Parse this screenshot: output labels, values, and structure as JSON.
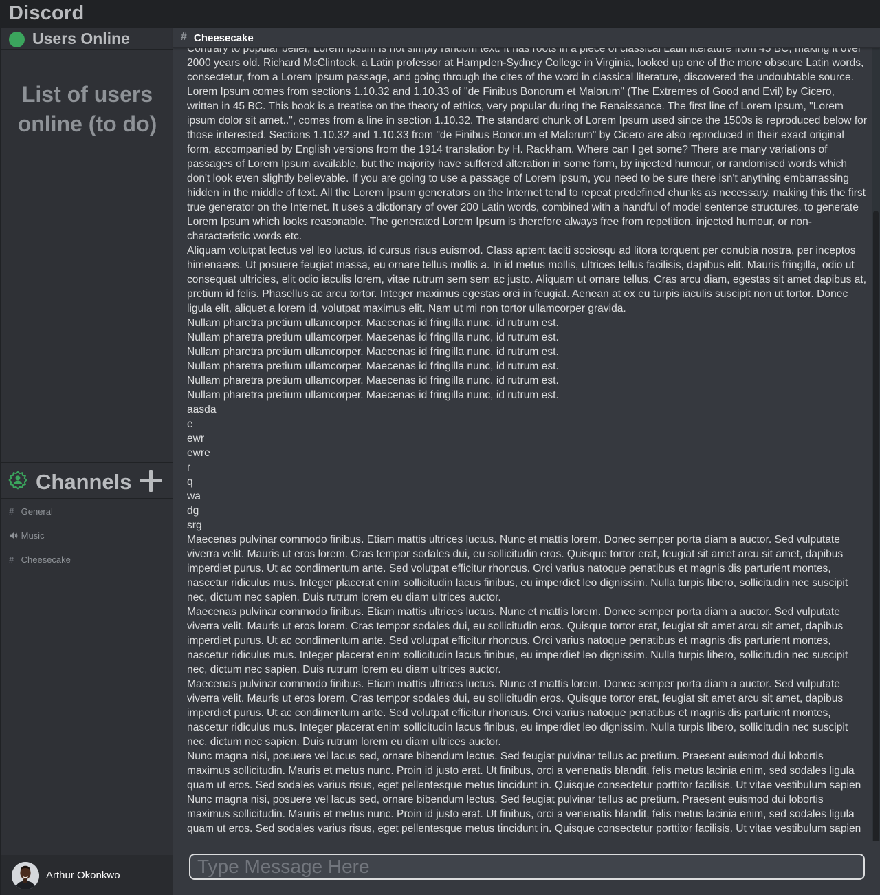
{
  "app": {
    "title": "Discord"
  },
  "users": {
    "header": "Users Online",
    "placeholder": "List of users online (to do)"
  },
  "channels": {
    "header": "Channels",
    "items": [
      {
        "name": "General",
        "type": "text",
        "icon": "hash-icon"
      },
      {
        "name": "Music",
        "type": "voice",
        "icon": "speaker-icon"
      },
      {
        "name": "Cheesecake",
        "type": "text",
        "icon": "hash-icon"
      }
    ]
  },
  "current_user": {
    "name": "Arthur Okonkwo"
  },
  "channel_header": {
    "hash": "#",
    "name": "Cheesecake"
  },
  "messages": [
    "Contrary to popular belief, Lorem Ipsum is not simply random text. It has roots in a piece of classical Latin literature from 45 BC, making it over 2000 years old. Richard McClintock, a Latin professor at Hampden-Sydney College in Virginia, looked up one of the more obscure Latin words, consectetur, from a Lorem Ipsum passage, and going through the cites of the word in classical literature, discovered the undoubtable source. Lorem Ipsum comes from sections 1.10.32 and 1.10.33 of \"de Finibus Bonorum et Malorum\" (The Extremes of Good and Evil) by Cicero, written in 45 BC. This book is a treatise on the theory of ethics, very popular during the Renaissance. The first line of Lorem Ipsum, \"Lorem ipsum dolor sit amet..\", comes from a line in section 1.10.32.  The standard chunk of Lorem Ipsum used since the 1500s is reproduced below for those interested. Sections 1.10.32 and 1.10.33 from \"de Finibus Bonorum et Malorum\" by Cicero are also reproduced in their exact original form, accompanied by English versions from the 1914 translation by H. Rackham.  Where can I get some? There are many variations of passages of Lorem Ipsum available, but the majority have suffered alteration in some form, by injected humour, or randomised words which don't look even slightly believable. If you are going to use a passage of Lorem Ipsum, you need to be sure there isn't anything embarrassing hidden in the middle of text. All the Lorem Ipsum generators on the Internet tend to repeat predefined chunks as necessary, making this the first true generator on the Internet. It uses a dictionary of over 200 Latin words, combined with a handful of model sentence structures, to generate Lorem Ipsum which looks reasonable. The generated Lorem Ipsum is therefore always free from repetition, injected humour, or non-characteristic words etc.",
    "Aliquam volutpat lectus vel leo luctus, id cursus risus euismod. Class aptent taciti sociosqu ad litora torquent per conubia nostra, per inceptos himenaeos. Ut posuere feugiat massa, eu ornare tellus mollis a. In id metus mollis, ultrices tellus facilisis, dapibus elit. Mauris fringilla, odio ut consequat ultricies, elit odio iaculis lorem, vitae rutrum sem sem ac justo. Aliquam ut ornare tellus. Cras arcu diam, egestas sit amet dapibus at, pretium id felis. Phasellus ac arcu tortor. Integer maximus egestas orci in feugiat. Aenean at ex eu turpis iaculis suscipit non ut tortor. Donec ligula elit, aliquet a lorem id, volutpat maximus elit. Nam ut mi non tortor ullamcorper gravida.",
    "Nullam pharetra pretium ullamcorper. Maecenas id fringilla nunc, id rutrum est.",
    "Nullam pharetra pretium ullamcorper. Maecenas id fringilla nunc, id rutrum est.",
    "Nullam pharetra pretium ullamcorper. Maecenas id fringilla nunc, id rutrum est.",
    "Nullam pharetra pretium ullamcorper. Maecenas id fringilla nunc, id rutrum est.",
    "Nullam pharetra pretium ullamcorper. Maecenas id fringilla nunc, id rutrum est.",
    "Nullam pharetra pretium ullamcorper. Maecenas id fringilla nunc, id rutrum est.",
    "aasda",
    "e",
    "ewr",
    "ewre",
    "r",
    "q",
    "wa",
    "dg",
    "srg",
    "Maecenas pulvinar commodo finibus. Etiam mattis ultrices luctus. Nunc et mattis lorem. Donec semper porta diam a auctor. Sed vulputate viverra velit. Mauris ut eros lorem. Cras tempor sodales dui, eu sollicitudin eros. Quisque tortor erat, feugiat sit amet arcu sit amet, dapibus imperdiet purus. Ut ac condimentum ante. Sed volutpat efficitur rhoncus. Orci varius natoque penatibus et magnis dis parturient montes, nascetur ridiculus mus. Integer placerat enim sollicitudin lacus finibus, eu imperdiet leo dignissim. Nulla turpis libero, sollicitudin nec suscipit nec, dictum nec sapien. Duis rutrum lorem eu diam ultrices auctor.",
    "Maecenas pulvinar commodo finibus. Etiam mattis ultrices luctus. Nunc et mattis lorem. Donec semper porta diam a auctor. Sed vulputate viverra velit. Mauris ut eros lorem. Cras tempor sodales dui, eu sollicitudin eros. Quisque tortor erat, feugiat sit amet arcu sit amet, dapibus imperdiet purus. Ut ac condimentum ante. Sed volutpat efficitur rhoncus. Orci varius natoque penatibus et magnis dis parturient montes, nascetur ridiculus mus. Integer placerat enim sollicitudin lacus finibus, eu imperdiet leo dignissim. Nulla turpis libero, sollicitudin nec suscipit nec, dictum nec sapien. Duis rutrum lorem eu diam ultrices auctor.",
    "Maecenas pulvinar commodo finibus. Etiam mattis ultrices luctus. Nunc et mattis lorem. Donec semper porta diam a auctor. Sed vulputate viverra velit. Mauris ut eros lorem. Cras tempor sodales dui, eu sollicitudin eros. Quisque tortor erat, feugiat sit amet arcu sit amet, dapibus imperdiet purus. Ut ac condimentum ante. Sed volutpat efficitur rhoncus. Orci varius natoque penatibus et magnis dis parturient montes, nascetur ridiculus mus. Integer placerat enim sollicitudin lacus finibus, eu imperdiet leo dignissim. Nulla turpis libero, sollicitudin nec suscipit nec, dictum nec sapien. Duis rutrum lorem eu diam ultrices auctor.",
    "Nunc magna nisi, posuere vel lacus sed, ornare bibendum lectus. Sed feugiat pulvinar tellus ac pretium. Praesent euismod dui lobortis maximus sollicitudin. Mauris et metus nunc. Proin id justo erat. Ut finibus, orci a venenatis blandit, felis metus lacinia enim, sed sodales ligula quam ut eros. Sed sodales varius risus, eget pellentesque metus tincidunt in. Quisque consectetur porttitor facilisis. Ut vitae vestibulum sapien",
    "Nunc magna nisi, posuere vel lacus sed, ornare bibendum lectus. Sed feugiat pulvinar tellus ac pretium. Praesent euismod dui lobortis maximus sollicitudin. Mauris et metus nunc. Proin id justo erat. Ut finibus, orci a venenatis blandit, felis metus lacinia enim, sed sodales ligula quam ut eros. Sed sodales varius risus, eget pellentesque metus tincidunt in. Quisque consectetur porttitor facilisis. Ut vitae vestibulum sapien"
  ],
  "composer": {
    "placeholder": "Type Message Here",
    "value": ""
  },
  "colors": {
    "titlebar": "#202225",
    "sidebar": "#2f3136",
    "main": "#36393f",
    "online": "#3ba55d",
    "user_bar": "#292b2f",
    "text": "#dcddde",
    "muted": "#8e9297"
  }
}
